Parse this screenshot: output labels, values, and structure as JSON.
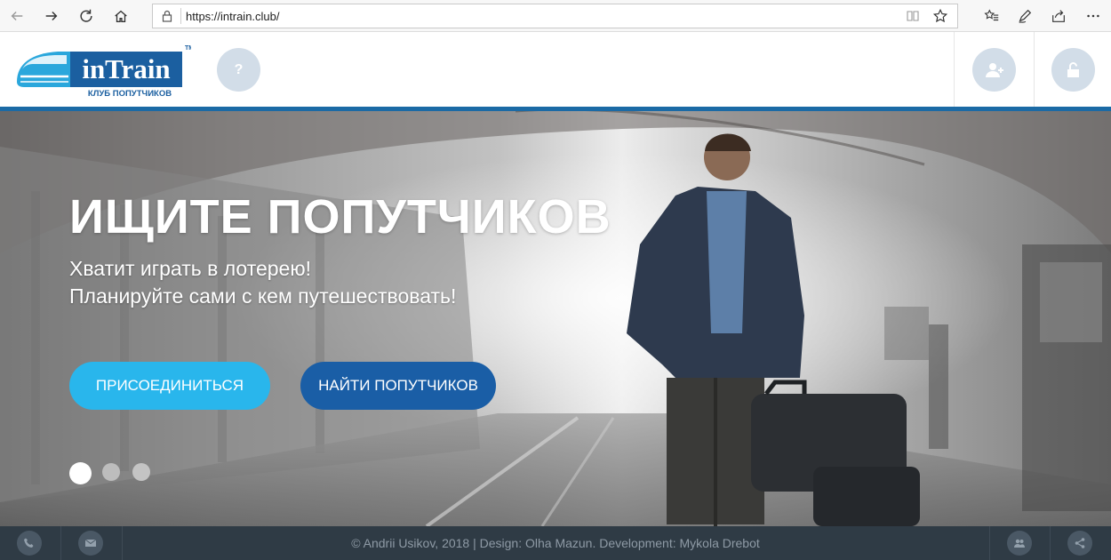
{
  "browser": {
    "url": "https://intrain.club/"
  },
  "header": {
    "logo_text": "inTrain",
    "logo_tagline": "КЛУБ ПОПУТЧИКОВ",
    "logo_tm": "TM",
    "help_label": "?"
  },
  "hero": {
    "title": "ИЩИТЕ ПОПУТЧИКОВ",
    "subtitle_line1": "Хватит играть в лотерею!",
    "subtitle_line2": "Планируйте сами с кем путешествовать!",
    "join_button": "ПРИСОЕДИНИТЬСЯ",
    "find_button": "НАЙТИ ПОПУТЧИКОВ",
    "slides_count": 3,
    "active_slide": 1
  },
  "footer": {
    "copyright": "© Andrii Usikov, 2018 | Design: Olha Mazun. Development: Mykola Drebot"
  },
  "colors": {
    "accent_blue": "#1b6aa5",
    "join_button": "#29b6ec",
    "find_button": "#1a5ea6",
    "footer_bg": "#2f3b45"
  },
  "icons": {
    "back": "arrow-left-icon",
    "forward": "arrow-right-icon",
    "refresh": "refresh-icon",
    "home": "home-icon",
    "lock": "lock-icon",
    "reading_view": "book-icon",
    "favorite": "star-icon",
    "favorites_list": "favorites-icon",
    "notes": "pen-icon",
    "share": "share-icon",
    "more": "more-icon",
    "register": "add-user-icon",
    "login": "unlock-icon",
    "phone": "phone-icon",
    "mail": "mail-icon",
    "group": "group-icon",
    "social_share": "share-nodes-icon"
  }
}
